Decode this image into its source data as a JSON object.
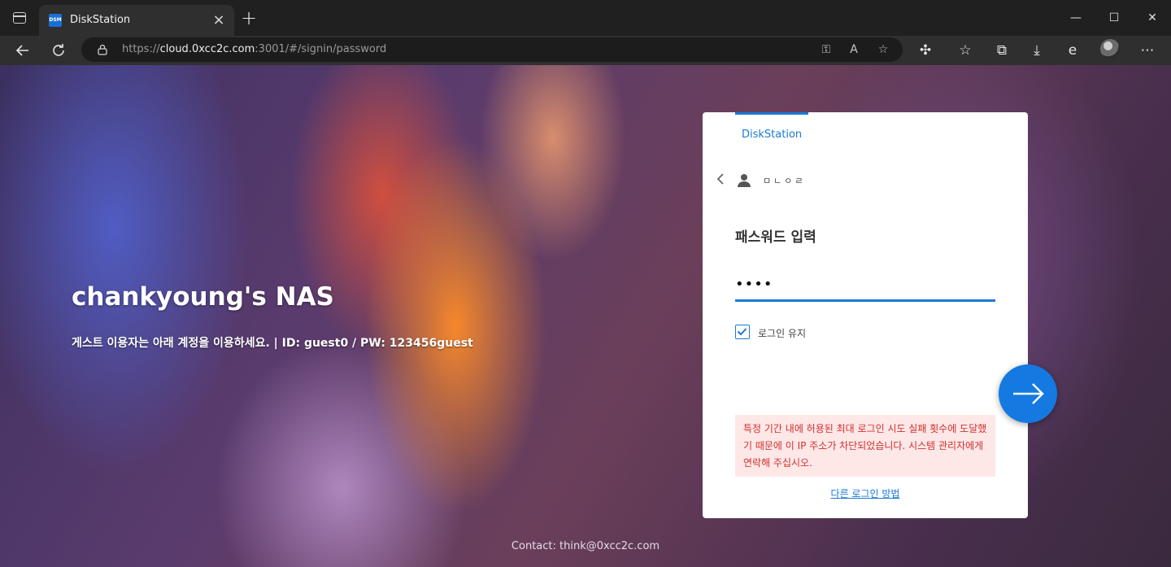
{
  "browser": {
    "tab_title": "DiskStation",
    "tab_favicon_text": "DSM",
    "new_tab_label": "+",
    "tab_close_label": "×",
    "url_prefix": "https://",
    "url_host": "cloud.0xcc2c.com",
    "url_rest": ":3001/#/signin/password",
    "window_controls": {
      "minimize": "—",
      "maximize": "☐",
      "close": "✕"
    }
  },
  "page": {
    "title": "chankyoung's NAS",
    "subtitle": "게스트 이용자는 아래 계정을 이용하세요. | ID: guest0 / PW: 123456guest",
    "contact": "Contact: think@0xcc2c.com"
  },
  "login": {
    "tab_label": "DiskStation",
    "username_display": "ㅁㄴㅇㄹ",
    "heading": "패스워드 입력",
    "password_value": "••••",
    "remember_label": "로그인 유지",
    "remember_checked": true,
    "error_message": "특정 기간 내에 허용된 최대 로그인 시도 실패 횟수에 도달했기 때문에 이 IP 주소가 차단되었습니다. 시스템 관리자에게 연락해 주십시오.",
    "other_login_label": "다른 로그인 방법",
    "accent_color": "#1a7ad6",
    "error_color": "#d0302f"
  },
  "icons": {
    "back": "back-arrow-icon",
    "refresh": "refresh-icon",
    "lock": "lock-icon",
    "user": "user-icon",
    "submit": "arrow-right-icon"
  }
}
